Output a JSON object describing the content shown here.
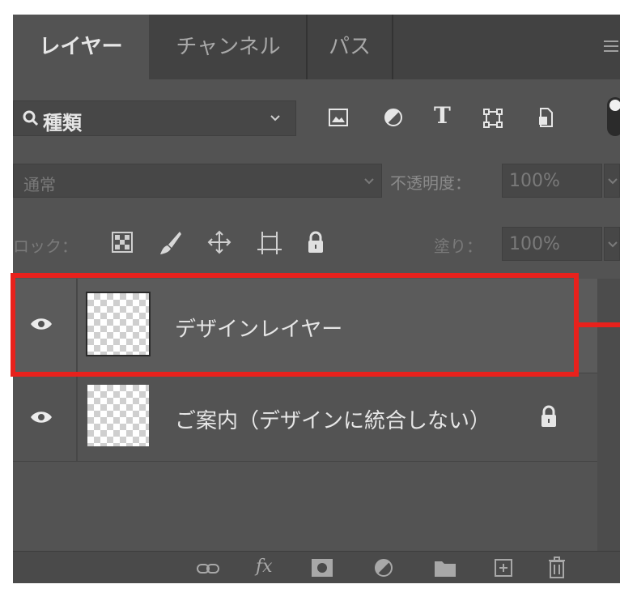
{
  "tabs": [
    {
      "label": "レイヤー",
      "active": true
    },
    {
      "label": "チャンネル",
      "active": false
    },
    {
      "label": "パス",
      "active": false
    }
  ],
  "filter": {
    "kind_label": "種類",
    "icons": [
      "image-filter-icon",
      "adjustment-filter-icon",
      "type-filter-icon",
      "shape-filter-icon",
      "smart-object-filter-icon",
      "filter-toggle-icon"
    ]
  },
  "blend": {
    "mode": "通常",
    "opacity_label": "不透明度：",
    "opacity_value": "100%"
  },
  "lock": {
    "label": "ロック：",
    "fill_label": "塗り：",
    "fill_value": "100%"
  },
  "layers": [
    {
      "name": "デザインレイヤー",
      "visible": true,
      "selected": true,
      "locked": false
    },
    {
      "name": "ご案内（デザインに統合しない）",
      "visible": true,
      "selected": false,
      "locked": true
    }
  ],
  "colors": {
    "panel_bg": "#535353",
    "tab_bar_bg": "#424242",
    "highlight": "#e8211c",
    "text": "#e6e6e6"
  }
}
